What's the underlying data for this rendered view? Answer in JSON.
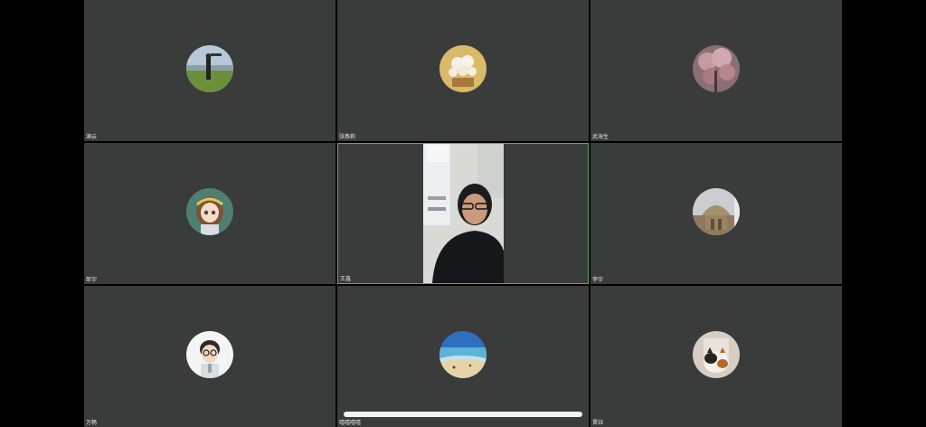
{
  "participants": [
    {
      "name": "满云",
      "avatar": "person-in-field-avatar"
    },
    {
      "name": "张燕莉",
      "avatar": "flower-bouquet-avatar"
    },
    {
      "name": "武海生",
      "avatar": "blossom-tree-avatar"
    },
    {
      "name": "郎宇",
      "avatar": "anime-girl-avatar"
    },
    {
      "name": "王鑫",
      "avatar": "live-video",
      "active": true
    },
    {
      "name": "李宇",
      "avatar": "domed-building-avatar"
    },
    {
      "name": "万畅",
      "avatar": "cartoon-man-avatar"
    },
    {
      "name": "嘻嘻嘻嘻",
      "avatar": "beach-avatar"
    },
    {
      "name": "晋钰",
      "avatar": "cat-avatar"
    }
  ],
  "colors": {
    "tile_bg": "#3a3b3b",
    "active_border": "#5ea86a",
    "background": "#000000"
  }
}
